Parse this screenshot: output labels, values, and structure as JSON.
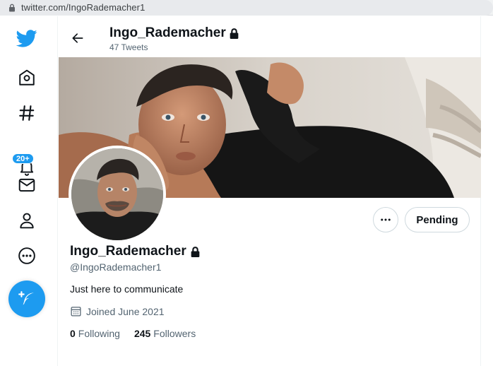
{
  "browser": {
    "url": "twitter.com/IngoRademacher1"
  },
  "sidebar": {
    "notifications_badge": "20+",
    "items": [
      "twitter-logo",
      "home-icon",
      "explore-icon",
      "notifications-icon",
      "messages-icon",
      "profile-icon",
      "more-icon",
      "compose-icon"
    ]
  },
  "header": {
    "name": "Ingo_Rademacher",
    "tweet_count": "47 Tweets"
  },
  "profile": {
    "name": "Ingo_Rademacher",
    "handle": "@IngoRademacher1",
    "bio": "Just here to communicate",
    "joined": "Joined June 2021",
    "following_count": "0",
    "following_label": "Following",
    "followers_count": "245",
    "followers_label": "Followers",
    "protected": true
  },
  "actions": {
    "pending_label": "Pending"
  },
  "colors": {
    "accent": "#1d9bf0",
    "text": "#0f1419",
    "secondary_text": "#536471"
  }
}
